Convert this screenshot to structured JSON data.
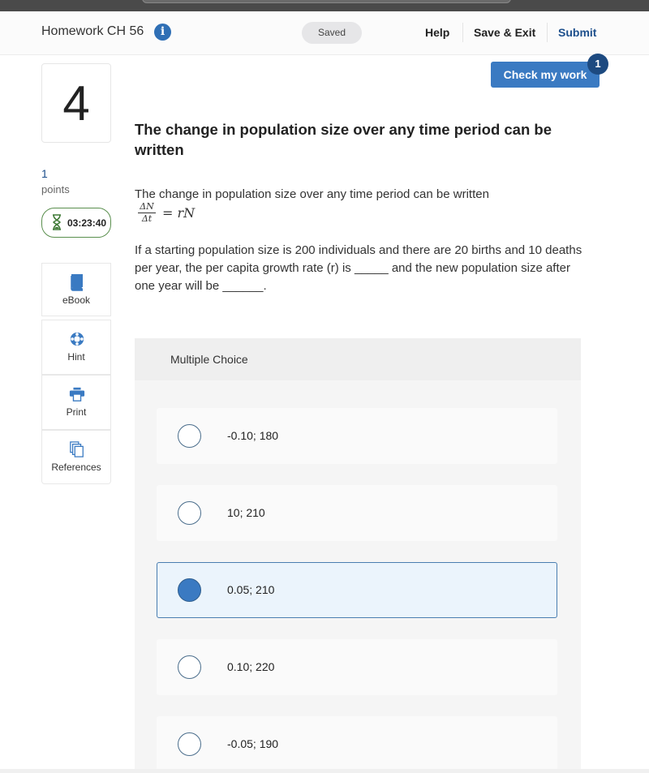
{
  "header": {
    "assignment_title": "Homework CH 56",
    "save_status": "Saved",
    "nav": {
      "help": "Help",
      "save_exit": "Save & Exit",
      "submit": "Submit"
    }
  },
  "check_work": {
    "label": "Check my work",
    "badge_count": "1"
  },
  "question": {
    "number": "4",
    "points_value": "1",
    "points_label": "points",
    "timer": "03:23:40",
    "heading": "The change in population size over any time period can be written",
    "intro": "The change in population size over any time period can be written",
    "formula": {
      "numerator": "ΔN",
      "denominator": "Δt",
      "rhs": "= rN"
    },
    "body": "If a starting population size is 200 individuals and there are 20 births and 10 deaths per year, the per capita growth rate (r) is _____ and the new population size after one year will be ______."
  },
  "tools": [
    {
      "label": "eBook",
      "icon": "book-icon"
    },
    {
      "label": "Hint",
      "icon": "lifebuoy-icon"
    },
    {
      "label": "Print",
      "icon": "printer-icon"
    },
    {
      "label": "References",
      "icon": "documents-icon"
    }
  ],
  "multiple_choice": {
    "title": "Multiple Choice",
    "options": [
      {
        "label": "-0.10; 180",
        "selected": false
      },
      {
        "label": "10; 210",
        "selected": false
      },
      {
        "label": "0.05; 210",
        "selected": true
      },
      {
        "label": "0.10; 220",
        "selected": false
      },
      {
        "label": "-0.05; 190",
        "selected": false
      }
    ]
  },
  "colors": {
    "accent": "#3a7ac2",
    "submit": "#1d4f8c",
    "timer_border": "#5a8f4e",
    "badge": "#1d4a80"
  }
}
